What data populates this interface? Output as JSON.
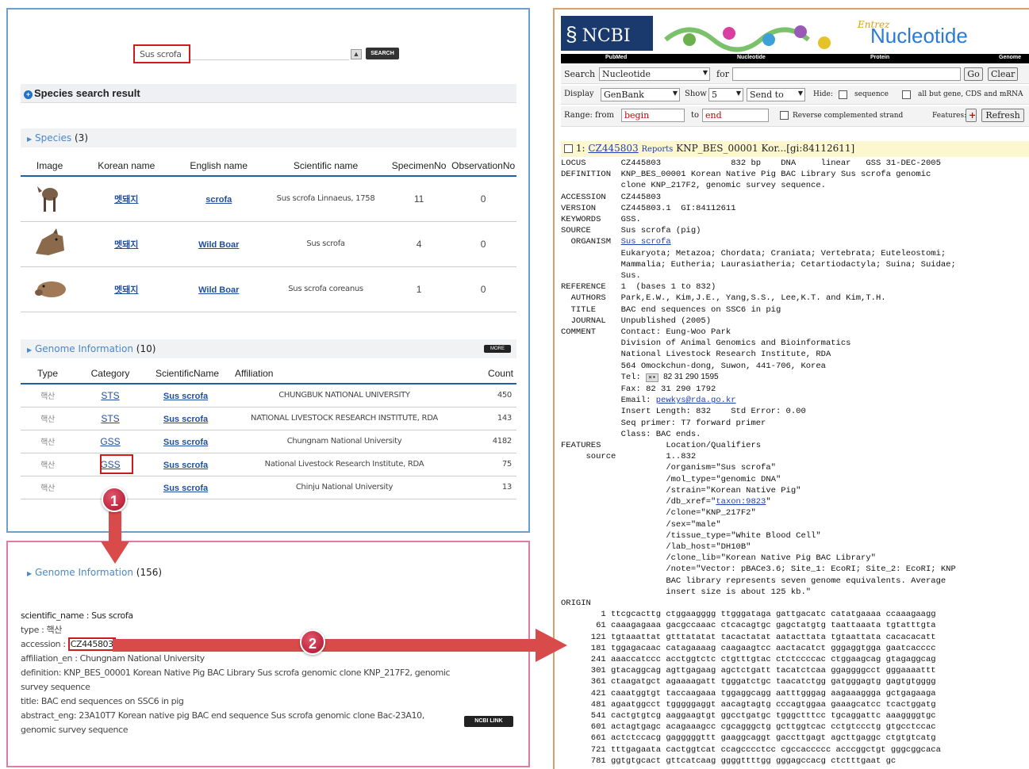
{
  "search": {
    "query": "Sus scrofa",
    "button": "SEARCH"
  },
  "species_result": {
    "title": "Species search result"
  },
  "species_section": {
    "label": "Species",
    "count": "(3)"
  },
  "species_table": {
    "headers": [
      "Image",
      "Korean name",
      "English name",
      "Scientific name",
      "SpecimenNo",
      "ObservationNo"
    ],
    "rows": [
      {
        "korean": "멧돼지",
        "english": "scrofa",
        "scientific": "Sus scrofa Linnaeus, 1758",
        "specimen": "11",
        "observation": "0"
      },
      {
        "korean": "멧돼지",
        "english": "Wild Boar",
        "scientific": "Sus scrofa",
        "specimen": "4",
        "observation": "0"
      },
      {
        "korean": "멧돼지",
        "english": "Wild Boar",
        "scientific": "Sus scrofa coreanus",
        "specimen": "1",
        "observation": "0"
      }
    ]
  },
  "genome_section": {
    "label": "Genome Information",
    "count": "(10)",
    "more": "MORE"
  },
  "genome_table": {
    "headers": [
      "Type",
      "Category",
      "ScientificName",
      "Affiliation",
      "Count"
    ],
    "rows": [
      {
        "type": "핵산",
        "category": "STS",
        "name": "Sus scrofa",
        "affiliation": "CHUNGBUK NATIONAL UNIVERSITY",
        "count": "450"
      },
      {
        "type": "핵산",
        "category": "STS",
        "name": "Sus scrofa",
        "affiliation": "NATIONAL LIVESTOCK RESEARCH INSTITUTE, RDA",
        "count": "143"
      },
      {
        "type": "핵산",
        "category": "GSS",
        "name": "Sus scrofa",
        "affiliation": "Chungnam National University",
        "count": "4182"
      },
      {
        "type": "핵산",
        "category": "GSS",
        "name": "Sus scrofa",
        "affiliation": "National Livestock Research Institute, RDA",
        "count": "75"
      },
      {
        "type": "핵산",
        "category": "",
        "name": "Sus scrofa",
        "affiliation": "Chinju National University",
        "count": "13"
      }
    ]
  },
  "badges": {
    "one": "1",
    "two": "2"
  },
  "detail_section": {
    "label": "Genome Information",
    "count": "(156)"
  },
  "detail": {
    "line1": "scientific_name : Sus scrofa",
    "line2": "type : 핵산",
    "acc_label": "accession : ",
    "acc_value": "CZ445803",
    "line4": "affiliation_en : Chungnam National University",
    "line5": "definition: KNP_BES_00001 Korean Native Pig BAC Library Sus scrofa genomic clone KNP_217F2, genomic",
    "line6": "survey sequence",
    "line7": "title: BAC end sequences on SSC6 in pig",
    "line8": "abstract_eng: 23A10T7 Korean native pig BAC end sequence Sus scrofa genomic clone Bac-23A10,",
    "line9": "genomic survey sequence",
    "link_btn": "NCBI LINK"
  },
  "ncbi": {
    "logo": "NCBI",
    "product": "Nucleotide",
    "entrez": "Entrez",
    "nav": [
      "PubMed",
      "Nucleotide",
      "Protein",
      "Genome"
    ],
    "search_label": "Search",
    "search_db": "Nucleotide",
    "for_label": "for",
    "go": "Go",
    "clear": "Clear",
    "display_label": "Display",
    "display_val": "GenBank",
    "show_label": "Show",
    "show_val": "5",
    "sendto": "Send to",
    "hide_label": "Hide:",
    "seq_label": "sequence",
    "allbut": "all but gene, CDS and mRNA",
    "range_label": "Range: from",
    "range_from": "begin",
    "to_label": "to",
    "range_to": "end",
    "revcomp": "Reverse complemented strand",
    "features": "Features:",
    "plus": "+",
    "refresh": "Refresh",
    "record_no": "1:",
    "record_acc": "CZ445803",
    "reports": "Reports",
    "record_title": "KNP_BES_00001 Kor...[gi:84112611]",
    "gb1": "LOCUS       CZ445803              832 bp    DNA     linear   GSS 31-DEC-2005\nDEFINITION  KNP_BES_00001 Korean Native Pig BAC Library Sus scrofa genomic\n            clone KNP_217F2, genomic survey sequence.\nACCESSION   CZ445803\nVERSION     CZ445803.1  GI:84112611\nKEYWORDS    GSS.\nSOURCE      Sus scrofa (pig)\n  ORGANISM  ",
    "organism_link": "Sus scrofa",
    "gb2": "\n            Eukaryota; Metazoa; Chordata; Craniata; Vertebrata; Euteleostomi;\n            Mammalia; Eutheria; Laurasiatheria; Cetartiodactyla; Suina; Suidae;\n            Sus.\nREFERENCE   1  (bases 1 to 832)\n  AUTHORS   Park,E.W., Kim,J.E., Yang,S.S., Lee,K.T. and Kim,T.H.\n  TITLE     BAC end sequences on SSC6 in pig\n  JOURNAL   Unpublished (2005)\nCOMMENT     Contact: Eung-Woo Park\n            Division of Animal Genomics and Bioinformatics\n            National Livestock Research Institute, RDA\n            564 Omockchun-dong, Suwon, 441-706, Korea\n            Tel: ",
    "tel": "82 31 290 1595",
    "gb3": "\n            Fax: 82 31 290 1792\n            Email: ",
    "email": "pewkys@rda.go.kr",
    "gb4": "\n            Insert Length: 832    Std Error: 0.00\n            Seq primer: T7 forward primer\n            Class: BAC ends.\nFEATURES             Location/Qualifiers\n     source          1..832\n                     /organism=\"Sus scrofa\"\n                     /mol_type=\"genomic DNA\"\n                     /strain=\"Korean Native Pig\"\n                     /db_xref=\"",
    "taxon": "taxon:9823",
    "gb5": "\"\n                     /clone=\"KNP_217F2\"\n                     /sex=\"male\"\n                     /tissue_type=\"White Blood Cell\"\n                     /lab_host=\"DH10B\"\n                     /clone_lib=\"Korean Native Pig BAC Library\"\n                     /note=\"Vector: pBACe3.6; Site_1: EcoRI; Site_2: EcoRI; KNP\n                     BAC library represents seven genome equivalents. Average\n                     insert size is about 125 kb.\"\nORIGIN\n        1 ttcgcacttg ctggaagggg ttgggataga gattgacatc catatgaaaa ccaaagaagg\n       61 caaagagaaa gacgccaaac ctcacagtgc gagctatgtg taattaaata tgtatttgta\n      121 tgtaaattat gtttatatat tacactatat aatacttata tgtaattata cacacacatt\n      181 tggagacaac catagaaaag caagaagtcc aactacatct gggaggtgga gaatcacccc\n      241 aaaccatccc acctggtctc ctgtttgtac ctctccccac ctggaagcag gtagaggcag\n      301 gtacaggcag agttgagaag agctctgatt tacatctcaa ggaggggcct gggaaaattt\n      361 ctaagatgct agaaaagatt tgggatctgc taacatctgg gatgggagtg gagtgtgggg\n      421 caaatggtgt taccaagaaa tggaggcagg aatttgggag aagaaaggga gctgagaaga\n      481 agaatggcct tgggggaggt aacagtagtg cccagtggaa gaaagcatcc tcactggatg\n      541 cactgtgtcg aaggaagtgt ggcctgatgc tgggctttcc tgcaggattc aaaggggtgc\n      601 actagtgagc acagaaagcc cgcagggctg gcttggtcac cctgtccctg gtgcctccac\n      661 actctccacg gagggggttt gaaggcaggt gaccttgagt agcttgaggc ctgtgtcatg\n      721 tttgagaata cactggtcat ccagcccctcc cgccaccccc acccggctgt gggcggcaca\n      781 ggtgtgcact gttcatcaag ggggttttgg gggagccacg ctctttgaat gc"
  }
}
